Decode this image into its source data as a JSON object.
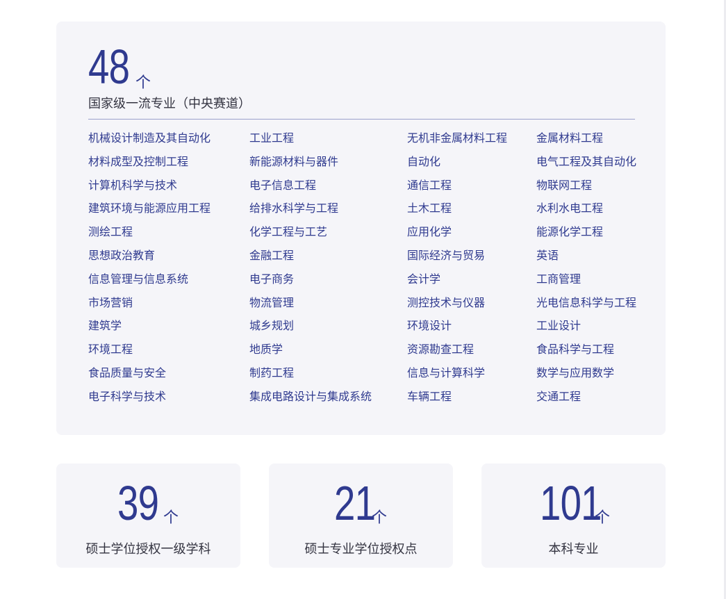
{
  "headline": {
    "number": "48",
    "unit": "个",
    "caption": "国家级一流专业（中央赛道）"
  },
  "majors": {
    "col1": [
      "机械设计制造及其自动化",
      "材料成型及控制工程",
      "计算机科学与技术",
      "建筑环境与能源应用工程",
      "测绘工程",
      "思想政治教育",
      "信息管理与信息系统",
      "市场营销",
      "建筑学",
      "环境工程",
      "食品质量与安全",
      "电子科学与技术"
    ],
    "col2": [
      "工业工程",
      "新能源材料与器件",
      "电子信息工程",
      "给排水科学与工程",
      "化学工程与工艺",
      "金融工程",
      "电子商务",
      "物流管理",
      "城乡规划",
      "地质学",
      "制药工程",
      "集成电路设计与集成系统"
    ],
    "col3": [
      "无机非金属材料工程",
      "自动化",
      "通信工程",
      "土木工程",
      "应用化学",
      "国际经济与贸易",
      "会计学",
      "测控技术与仪器",
      "环境设计",
      "资源勘查工程",
      "信息与计算科学",
      "车辆工程"
    ],
    "col4": [
      "金属材料工程",
      "电气工程及其自动化",
      "物联网工程",
      "水利水电工程",
      "能源化学工程",
      "英语",
      "工商管理",
      "光电信息科学与工程",
      "工业设计",
      "食品科学与工程",
      "数学与应用数学",
      "交通工程"
    ]
  },
  "stats": [
    {
      "number": "39",
      "unit": "个",
      "label": "硕士学位授权一级学科"
    },
    {
      "number": "21",
      "unit": "个",
      "label": "硕士专业学位授权点"
    },
    {
      "number": "101",
      "unit": "个",
      "label": "本科专业"
    }
  ],
  "colors": {
    "accent": "#2f3a8f",
    "card": "#f5f5f9",
    "text": "#333340"
  }
}
